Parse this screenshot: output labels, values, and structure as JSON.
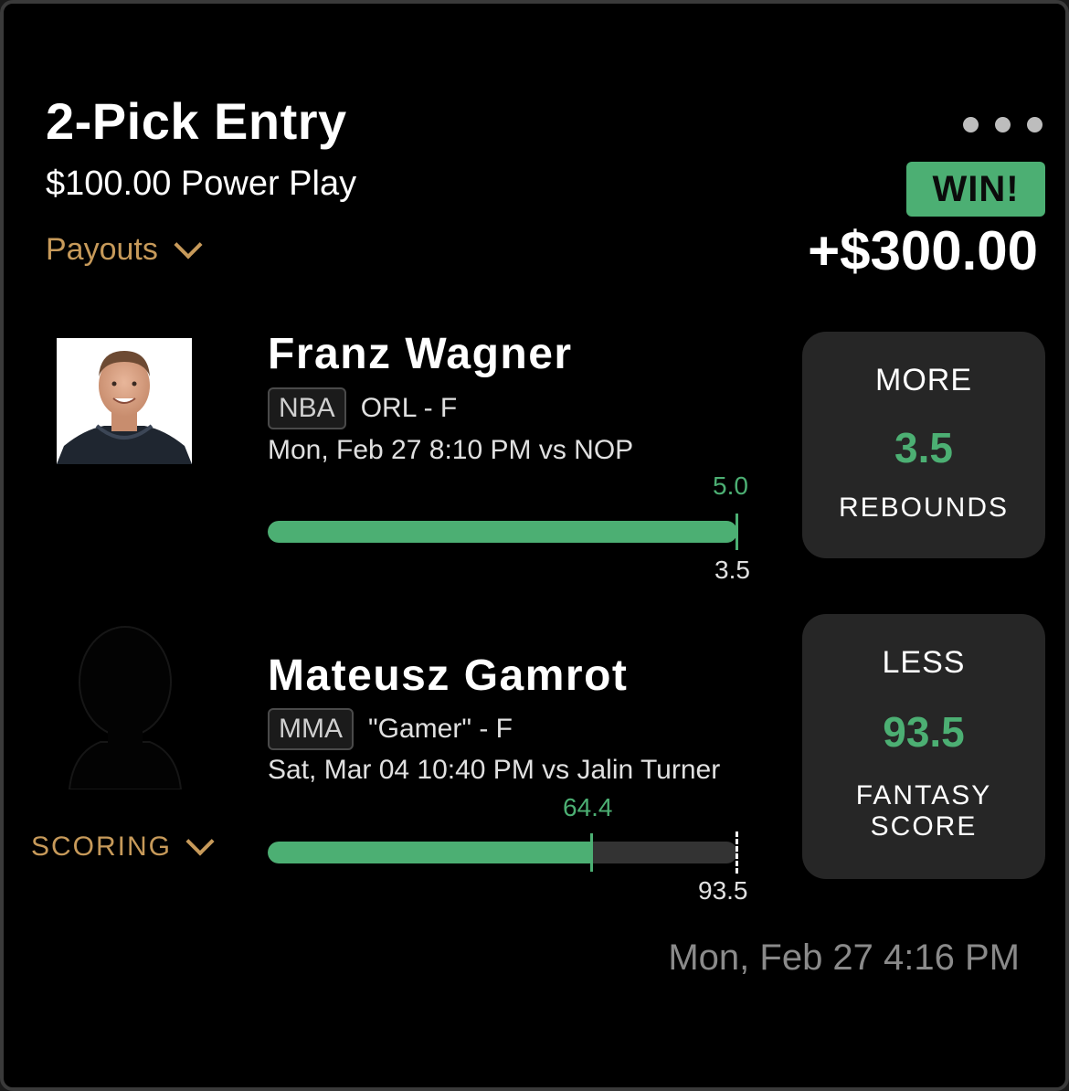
{
  "entry": {
    "title": "2-Pick Entry",
    "subtitle": "$100.00 Power Play",
    "payouts_label": "Payouts",
    "result_badge": "WIN!",
    "winnings": "+$300.00",
    "created_at": "Mon, Feb 27 4:16 PM"
  },
  "picks": [
    {
      "player": "Franz Wagner",
      "league": "NBA",
      "team_position": "ORL - F",
      "game": "Mon, Feb 27 8:10 PM  vs NOP",
      "actual": "5.0",
      "line": "3.5",
      "direction": "MORE",
      "stat": "REBOUNDS",
      "progress_fraction": 1.0
    },
    {
      "player": "Mateusz Gamrot",
      "league": "MMA",
      "team_position": "\"Gamer\" - F",
      "game": "Sat, Mar 04 10:40 PM  vs Jalin Turner",
      "actual": "64.4",
      "line": "93.5",
      "direction": "LESS",
      "stat_line1": "FANTASY",
      "stat_line2": "SCORE",
      "progress_fraction": 0.689,
      "scoring_label": "SCORING"
    }
  ],
  "colors": {
    "accent_green": "#4caf73",
    "accent_gold": "#c79a5a",
    "card_bg": "#000000",
    "pick_box_bg": "#262626"
  },
  "icons": [
    "more-dots-icon",
    "chevron-down-icon",
    "player-silhouette-icon"
  ]
}
